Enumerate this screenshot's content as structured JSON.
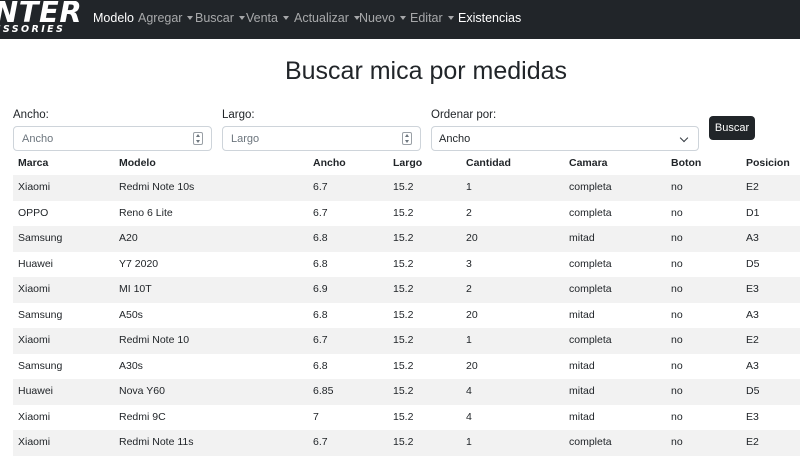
{
  "navbar": {
    "brand_main": "NTER",
    "brand_sub": "ESSORIES",
    "items": [
      {
        "label": "Modelo",
        "dropdown": false,
        "active": true
      },
      {
        "label": "Agregar",
        "dropdown": true,
        "active": false
      },
      {
        "label": "Buscar",
        "dropdown": true,
        "active": false
      },
      {
        "label": "Venta",
        "dropdown": true,
        "active": false
      },
      {
        "label": "Actualizar",
        "dropdown": true,
        "active": false
      },
      {
        "label": "Nuevo",
        "dropdown": true,
        "active": false
      },
      {
        "label": "Editar",
        "dropdown": true,
        "active": false
      },
      {
        "label": "Existencias",
        "dropdown": false,
        "active": true
      }
    ]
  },
  "page": {
    "title": "Buscar mica por medidas"
  },
  "form": {
    "ancho": {
      "label": "Ancho:",
      "placeholder": "Ancho",
      "value": ""
    },
    "largo": {
      "label": "Largo:",
      "placeholder": "Largo",
      "value": ""
    },
    "ordenar": {
      "label": "Ordenar por:",
      "selected": "Ancho"
    },
    "submit_label": "Buscar"
  },
  "table": {
    "columns": [
      "Marca",
      "Modelo",
      "Ancho",
      "Largo",
      "Cantidad",
      "Camara",
      "Boton",
      "Posicion"
    ],
    "rows": [
      [
        "Xiaomi",
        "Redmi Note 10s",
        "6.7",
        "15.2",
        "1",
        "completa",
        "no",
        "E2"
      ],
      [
        "OPPO",
        "Reno 6 Lite",
        "6.7",
        "15.2",
        "2",
        "completa",
        "no",
        "D1"
      ],
      [
        "Samsung",
        "A20",
        "6.8",
        "15.2",
        "20",
        "mitad",
        "no",
        "A3"
      ],
      [
        "Huawei",
        "Y7 2020",
        "6.8",
        "15.2",
        "3",
        "completa",
        "no",
        "D5"
      ],
      [
        "Xiaomi",
        "MI 10T",
        "6.9",
        "15.2",
        "2",
        "completa",
        "no",
        "E3"
      ],
      [
        "Samsung",
        "A50s",
        "6.8",
        "15.2",
        "20",
        "mitad",
        "no",
        "A3"
      ],
      [
        "Xiaomi",
        "Redmi Note 10",
        "6.7",
        "15.2",
        "1",
        "completa",
        "no",
        "E2"
      ],
      [
        "Samsung",
        "A30s",
        "6.8",
        "15.2",
        "20",
        "mitad",
        "no",
        "A3"
      ],
      [
        "Huawei",
        "Nova Y60",
        "6.85",
        "15.2",
        "4",
        "mitad",
        "no",
        "D5"
      ],
      [
        "Xiaomi",
        "Redmi 9C",
        "7",
        "15.2",
        "4",
        "mitad",
        "no",
        "E3"
      ],
      [
        "Xiaomi",
        "Redmi Note 11s",
        "6.7",
        "15.2",
        "1",
        "completa",
        "no",
        "E2"
      ]
    ]
  }
}
